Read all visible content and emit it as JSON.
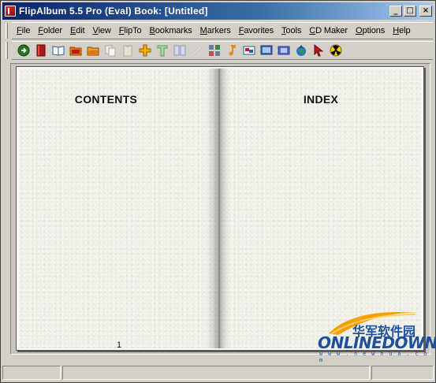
{
  "window": {
    "title": "FlipAlbum 5.5 Pro (Eval)    Book: [Untitled]",
    "minimize": "_",
    "maximize": "□",
    "close": "×"
  },
  "menu": [
    "File",
    "Folder",
    "Edit",
    "View",
    "FlipTo",
    "Bookmarks",
    "Markers",
    "Favorites",
    "Tools",
    "CD Maker",
    "Options",
    "Help"
  ],
  "toolbar": [
    {
      "icon": "go-icon",
      "color": "#2e8b2e"
    },
    {
      "icon": "red-book-icon",
      "color": "#b01818"
    },
    {
      "icon": "open-book-icon",
      "color": "#2a5aa8"
    },
    {
      "icon": "folder-icon",
      "color": "#e07a10"
    },
    {
      "icon": "folder-open-icon",
      "color": "#e07a10"
    },
    {
      "icon": "copy-icon",
      "color": "#bdbdbd"
    },
    {
      "icon": "paste-icon",
      "color": "#bdbdbd"
    },
    {
      "icon": "add-icon",
      "color": "#f0b000"
    },
    {
      "icon": "text-icon",
      "color": "#7ab87a"
    },
    {
      "icon": "pages-icon",
      "color": "#a8b8d8"
    },
    {
      "icon": "link-icon",
      "color": "#b8c0d8"
    },
    {
      "icon": "grid-icon",
      "color": "#6a7aa8"
    },
    {
      "icon": "music-icon",
      "color": "#e08a10"
    },
    {
      "icon": "slideshow-icon",
      "color": "#2a5aa8"
    },
    {
      "icon": "screen-icon",
      "color": "#3a6ab8"
    },
    {
      "icon": "filmstrip-icon",
      "color": "#5a6ac8"
    },
    {
      "icon": "globe-upload-icon",
      "color": "#2a6a3a"
    },
    {
      "icon": "pointer-icon",
      "color": "#c01818"
    },
    {
      "icon": "radiation-icon",
      "color": "#f0d000"
    }
  ],
  "book": {
    "left_heading": "CONTENTS",
    "right_heading": "INDEX",
    "left_page_number": "1"
  },
  "watermark": {
    "cn": "华军软件园",
    "en": "ONLINEDOWN",
    "url": "w w w . n e w h u a . c o m"
  },
  "status": [
    "",
    "",
    ""
  ]
}
